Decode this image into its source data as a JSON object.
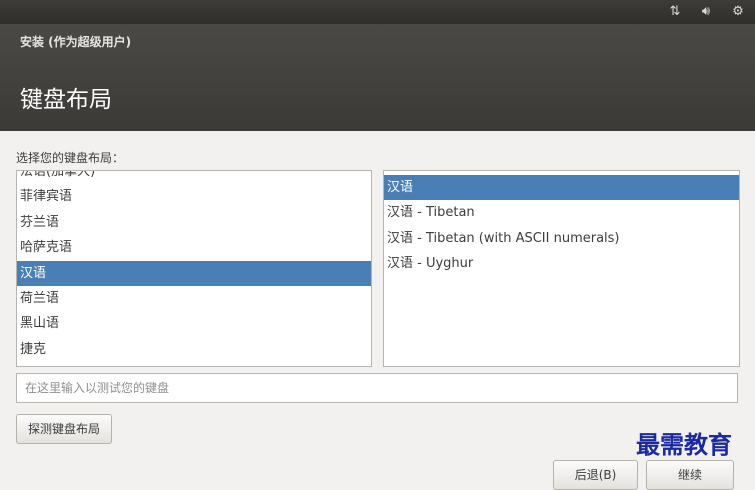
{
  "tray": {
    "network_icon": "network-arrows-icon",
    "volume_icon": "volume-icon",
    "settings_icon": "gear-icon"
  },
  "window": {
    "title": "安装 (作为超级用户)"
  },
  "page": {
    "title": "键盘布局",
    "prompt": "选择您的键盘布局："
  },
  "layouts": {
    "items": [
      "法语(加拿大)",
      "菲律宾语",
      "芬兰语",
      "哈萨克语",
      "汉语",
      "荷兰语",
      "黑山语",
      "捷克"
    ],
    "selected": "汉语"
  },
  "variants": {
    "items": [
      "汉语",
      "汉语 - Tibetan",
      "汉语 - Tibetan (with ASCII numerals)",
      "汉语 - Uyghur"
    ],
    "selected": "汉语"
  },
  "test": {
    "placeholder": "在这里输入以测试您的键盘"
  },
  "buttons": {
    "detect": "探测键盘布局",
    "back": "后退(B)",
    "continue": "继续"
  },
  "watermark": "最需教育",
  "colors": {
    "selection": "#4a7fb5",
    "header": "#3b3a36",
    "background": "#f2f1f0"
  }
}
